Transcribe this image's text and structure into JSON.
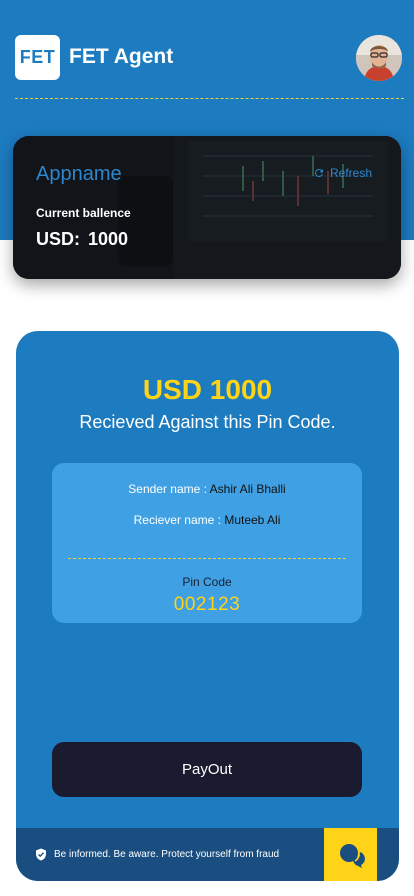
{
  "header": {
    "logo_text": "FET",
    "title": "FET Agent",
    "avatar_icon": "user-avatar"
  },
  "balance_card": {
    "app_name": "Appname",
    "refresh_label": "Refresh",
    "balance_label": "Current ballence",
    "currency": "USD:",
    "amount": "1000"
  },
  "transaction": {
    "amount_text": "USD 1000",
    "received_text": "Recieved Against this Pin Code.",
    "sender_label": "Sender name :",
    "sender_value": "Ashir Ali Bhalli",
    "receiver_label": "Reciever name :",
    "receiver_value": "Muteeb Ali",
    "pin_label": "Pin Code",
    "pin_value": "002123"
  },
  "actions": {
    "payout_label": "PayOut"
  },
  "footer": {
    "fraud_notice": "Be informed. Be aware. Protect yourself from fraud",
    "chat_icon": "chat-icon"
  },
  "colors": {
    "primary": "#1d7bc0",
    "accent": "#ffd317",
    "info_box": "#3fa0e3",
    "button_dark": "#1a1b2e",
    "footer_bar": "#1a4e80"
  }
}
